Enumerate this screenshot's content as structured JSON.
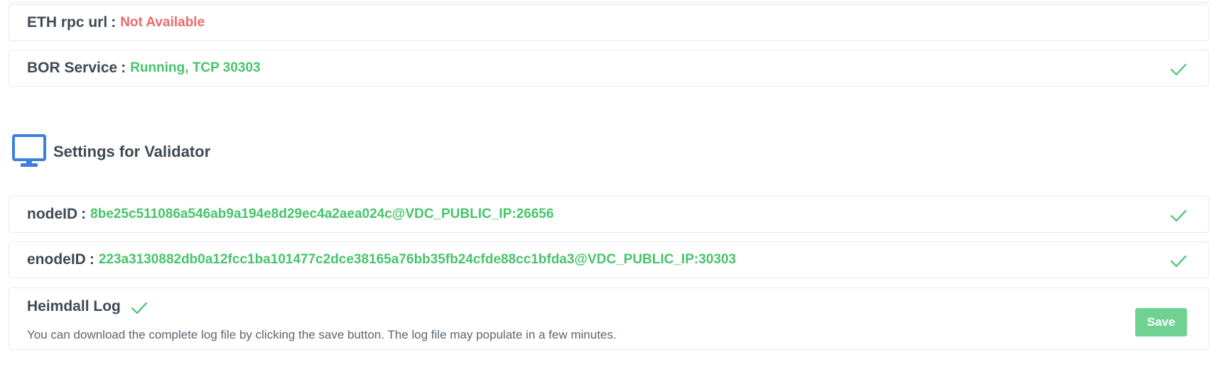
{
  "rows": {
    "eth_rpc": {
      "label": "ETH rpc url",
      "value": "Not Available",
      "status_color": "#ec6a6a"
    },
    "bor": {
      "label": "BOR Service",
      "value": "Running, TCP 30303",
      "status_color": "#47c46a"
    },
    "node_id": {
      "label": "nodeID",
      "value": "8be25c511086a546ab9a194e8d29ec4a2aea024c@VDC_PUBLIC_IP:26656"
    },
    "enode_id": {
      "label": "enodeID",
      "value": "223a3130882db0a12fcc1ba101477c2dce38165a76bb35fb24cfde88cc1bfda3@VDC_PUBLIC_IP:30303"
    }
  },
  "separator": ":",
  "section": {
    "title": "Settings for Validator",
    "icon": "monitor-icon"
  },
  "heimdall_log": {
    "title": "Heimdall Log",
    "description": "You can download the complete log file by clicking the save button. The log file may populate in a few minutes.",
    "save_label": "Save"
  },
  "colors": {
    "accent_green": "#47c46a",
    "icon_blue": "#3d7fe0",
    "button_green": "#6fd293"
  }
}
